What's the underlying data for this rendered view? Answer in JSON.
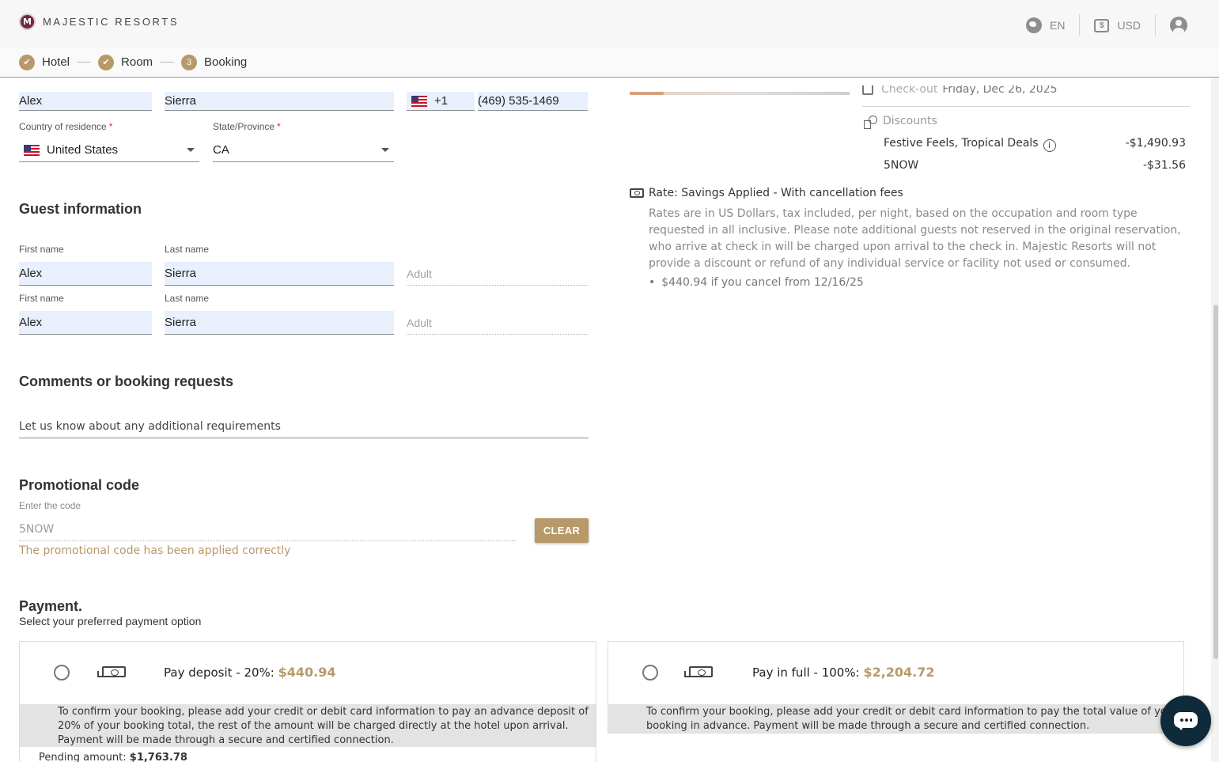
{
  "header": {
    "brand": "MAJESTIC RESORTS",
    "logo_letter": "M",
    "language": "EN",
    "currency_symbol": "$",
    "currency": "USD"
  },
  "steps": [
    {
      "label": "Hotel",
      "state": "done"
    },
    {
      "label": "Room",
      "state": "done"
    },
    {
      "label": "Booking",
      "state": "current",
      "number": "3"
    }
  ],
  "contact": {
    "first_name": "Alex",
    "last_name": "Sierra",
    "phone_code": "+1",
    "phone": "(469) 535-1469",
    "country_label": "Country of residence",
    "country": "United States",
    "state_label": "State/Province",
    "state": "CA",
    "required_mark": "*"
  },
  "guest_info": {
    "title": "Guest information",
    "guests": [
      {
        "first_label": "First name",
        "last_label": "Last name",
        "first": "Alex",
        "last": "Sierra",
        "type": "Adult"
      },
      {
        "first_label": "First name",
        "last_label": "Last name",
        "first": "Alex",
        "last": "Sierra",
        "type": "Adult"
      }
    ]
  },
  "comments": {
    "title": "Comments or booking requests",
    "placeholder": "Let us know about any additional requirements"
  },
  "promo": {
    "title": "Promotional code",
    "label": "Enter the code",
    "value": "5NOW",
    "clear_button": "CLEAR",
    "success": "The promotional code has been applied correctly"
  },
  "payment": {
    "title": "Payment.",
    "subtitle": "Select your preferred payment option",
    "options": [
      {
        "label": "Pay deposit - 20%: ",
        "amount": "$440.94",
        "description": "To confirm your booking, please add your credit or debit card information to pay an advance deposit of 20% of your booking total, the rest of the amount will be charged directly at the hotel upon arrival. Payment will be made through a secure and certified connection.",
        "pending_label": "Pending amount: ",
        "pending_amount": "$1,763.78"
      },
      {
        "label": "Pay in full - 100%: ",
        "amount": "$2,204.72",
        "description": "To confirm your booking, please add your credit or debit card information to pay the total value of your booking in advance. Payment will be made through a secure and certified connection."
      }
    ],
    "accent_color": "#b8996a"
  },
  "summary": {
    "checkout_label": "Check-out",
    "checkout_date": "Friday, Dec 26, 2025",
    "discounts_title": "Discounts",
    "discounts": [
      {
        "name": "Festive Feels, Tropical Deals",
        "amount": "-$1,490.93",
        "has_info": true
      },
      {
        "name": "5NOW",
        "amount": "-$31.56",
        "has_info": false
      }
    ],
    "rate_title": "Rate: Savings Applied - With cancellation fees",
    "rate_text": "Rates are in US Dollars, tax included, per night, based on the occupation and room type requested in all inclusive. Please note additional guests not reserved in the original reservation, who arrive at check in will be charged upon arrival to the check in. Majestic Resorts will not provide a discount or refund of any individual service or facility not used or consumed.",
    "cancel_note": "$440.94 if you cancel from 12/16/25"
  }
}
